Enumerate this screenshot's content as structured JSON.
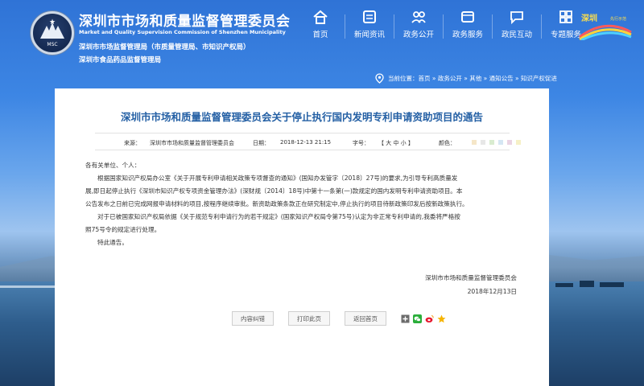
{
  "org": {
    "title": "深圳市市场和质量监督管理委员会",
    "title_en": "Market and Quality Supervision Commission of Shenzhen Municipality",
    "sub1": "深圳市市场监督管理局（市质量管理局、市知识产权局）",
    "sub2": "深圳市食品药品监督管理局",
    "emblem_text": "MSC"
  },
  "nav": [
    {
      "label": "首页",
      "icon": "home-icon"
    },
    {
      "label": "新闻资讯",
      "icon": "news-icon"
    },
    {
      "label": "政务公开",
      "icon": "people-icon"
    },
    {
      "label": "政务服务",
      "icon": "service-icon"
    },
    {
      "label": "政民互动",
      "icon": "chat-icon"
    },
    {
      "label": "专题服务",
      "icon": "topic-icon"
    }
  ],
  "badge": {
    "text": "深圳",
    "sub": "先行示范"
  },
  "location": {
    "prefix": "当前位置：",
    "path": "首页 » 政务公开 » 其他 » 通知公告 » 知识产权促进"
  },
  "article": {
    "title": "深圳市市场和质量监督管理委员会关于停止执行国内发明专利申请资助项目的通告",
    "source_label": "来源：",
    "source": "深圳市市场和质量监督管理委员会",
    "date_label": "日期：",
    "date": "2018-12-13 21:15",
    "size_label": "字号：",
    "size_options": "【 大  中  小 】",
    "color_label": "颜色：",
    "greeting": "各有关单位、个人：",
    "p1_l1": "根据国家知识产权局办公室《关于开展专利申请相关政策专项督查的通知》(国知办发管字〔2018〕27号)的要求,为引导专利高质量发",
    "p1_l2": "展,即日起停止执行《深圳市知识产权专项资金管理办法》(深财规〔2014〕18号)中第十一条第(一)款规定的国内发明专利申请资助项目。本",
    "p1_l3": "公告发布之日前已完成网报申请材料的项目,按程序继续审批。新资助政策条款正在研究制定中,停止执行的项目待新政策印发后按新政策执行。",
    "p2_l1": "对于已被国家知识产权局依据《关于规范专利申请行为的若干规定》(国家知识产权局令第75号)认定为非正常专利申请的,我委将严格按",
    "p2_l2": "照75号令的规定进行处理。",
    "closing": "特此通告。",
    "signature": "深圳市市场和质量监督管理委员会",
    "sign_date": "2018年12月13日"
  },
  "actions": {
    "correct": "内容纠错",
    "print": "打印此页",
    "back": "返回首页"
  },
  "colors": {
    "title_blue": "#235fa4",
    "dots": [
      "#f5e6c8",
      "#e7e7e7",
      "#d9ecd0",
      "#d5e6f3",
      "#ead3e3",
      "#f6f0c6"
    ]
  }
}
